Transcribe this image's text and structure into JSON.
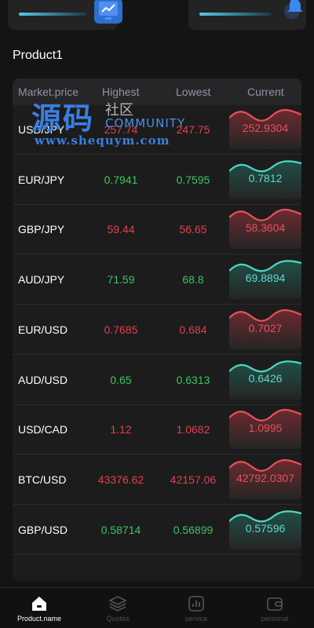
{
  "top_cards": [
    {
      "name": "left-summary"
    },
    {
      "name": "right-summary"
    }
  ],
  "section_title": "Product1",
  "table": {
    "headers": {
      "market": "Market.price",
      "highest": "Highest",
      "lowest": "Lowest",
      "current": "Current"
    },
    "rows": [
      {
        "pair": "USD/JPY",
        "highest": "257.74",
        "lowest": "247.75",
        "current": "252.9304",
        "trend": "up"
      },
      {
        "pair": "EUR/JPY",
        "highest": "0.7941",
        "lowest": "0.7595",
        "current": "0.7812",
        "trend": "down"
      },
      {
        "pair": "GBP/JPY",
        "highest": "59.44",
        "lowest": "56.65",
        "current": "58.3604",
        "trend": "up"
      },
      {
        "pair": "AUD/JPY",
        "highest": "71.59",
        "lowest": "68.8",
        "current": "69.8894",
        "trend": "down"
      },
      {
        "pair": "EUR/USD",
        "highest": "0.7685",
        "lowest": "0.684",
        "current": "0.7027",
        "trend": "up"
      },
      {
        "pair": "AUD/USD",
        "highest": "0.65",
        "lowest": "0.6313",
        "current": "0.6426",
        "trend": "down"
      },
      {
        "pair": "USD/CAD",
        "highest": "1.12",
        "lowest": "1.0682",
        "current": "1.0995",
        "trend": "up"
      },
      {
        "pair": "BTC/USD",
        "highest": "43376.62",
        "lowest": "42157.06",
        "current": "42792.0307",
        "trend": "up"
      },
      {
        "pair": "GBP/USD",
        "highest": "0.58714",
        "lowest": "0.56899",
        "current": "0.57596",
        "trend": "down"
      }
    ]
  },
  "watermark": {
    "big": "源码",
    "small": "社区",
    "community": "COMMUNITY",
    "url": "www.shequym.com"
  },
  "nav": [
    {
      "label": "Product.name",
      "icon": "home-icon",
      "active": true
    },
    {
      "label": "Quotes",
      "icon": "layers-icon",
      "active": false
    },
    {
      "label": "service",
      "icon": "chart-icon",
      "active": false
    },
    {
      "label": "personal",
      "icon": "wallet-icon",
      "active": false
    }
  ],
  "colors": {
    "up": "#e0404f",
    "down": "#3cc463",
    "accent": "#2f6fd0"
  }
}
